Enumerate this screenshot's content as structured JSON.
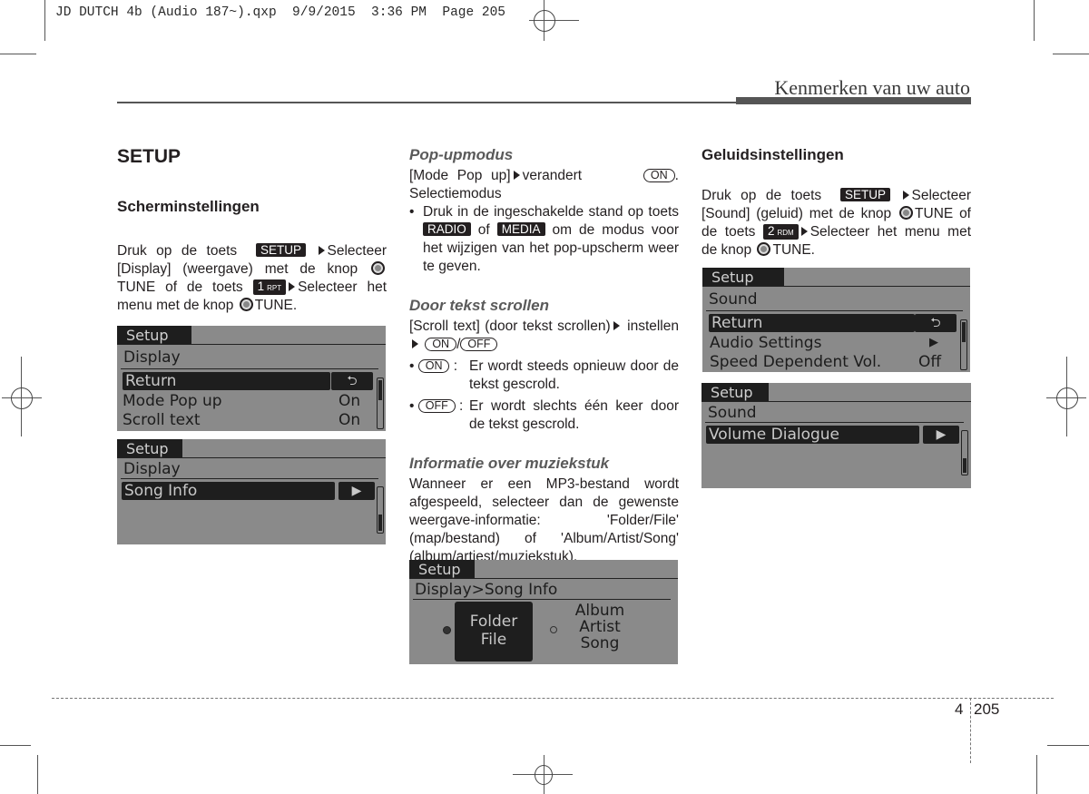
{
  "slug": "JD DUTCH 4b (Audio 187~).qxp  9/9/2015  3:36 PM  Page 205",
  "running_head": "Kenmerken van uw auto",
  "col1": {
    "title": "SETUP",
    "subtitle": "Scherminstellingen",
    "p1": "Druk op de toets",
    "key_setup": "SETUP",
    "p2": "Selecteer [Display] (weergave) met de knop",
    "p3": "TUNE of de toets",
    "key_1": "1",
    "key_1_sub": "RPT",
    "p4": "Selecteer het menu met de knop",
    "p5": "TUNE.",
    "lcd1": {
      "tab": "Setup",
      "crumb": "Display",
      "rows": [
        {
          "label": "Return",
          "value": "⮌",
          "selected": true
        },
        {
          "label": "Mode Pop up",
          "value": "On"
        },
        {
          "label": "Scroll text",
          "value": "On"
        }
      ]
    },
    "lcd2": {
      "tab": "Setup",
      "crumb": "Display",
      "rows": [
        {
          "label": "Song Info",
          "value": "▶",
          "selected": true
        }
      ]
    }
  },
  "col2": {
    "h_popup": "Pop-upmodus",
    "popup_p1": "[Mode Pop up]",
    "popup_p2": "verandert",
    "pill_on": "ON",
    "popup_p3": ".",
    "popup_p4": "Selectiemodus",
    "popup_bullet_a": "Druk in de ingeschakelde stand op toets",
    "key_radio": "RADIO",
    "of": "of",
    "key_media": "MEDIA",
    "popup_bullet_b": "om de modus voor het wijzigen van het pop-upscherm weer te geven.",
    "h_scroll": "Door tekst scrollen",
    "scroll_p1": "[Scroll text] (door tekst scrollen)",
    "scroll_p2": "instellen",
    "pill_off": "OFF",
    "slash": "/",
    "def_on": "Er wordt steeds opnieuw door de tekst gescrold.",
    "def_off": "Er wordt slechts één keer door de tekst gescrold.",
    "h_info": "Informatie over muziekstuk",
    "info_p": "Wanneer er een MP3-bestand wordt afgespeeld, selecteer dan de gewenste weergave-informatie: 'Folder/File' (map/bestand) of 'Album/Artist/Song' (album/artiest/muziekstuk).",
    "lcd3": {
      "tab": "Setup",
      "crumb": "Display>Song Info",
      "option_a_l1": "Folder",
      "option_a_l2": "File",
      "option_b_l1": "Album",
      "option_b_l2": "Artist",
      "option_b_l3": "Song",
      "selected": "Folder/File"
    }
  },
  "col3": {
    "subtitle": "Geluidsinstellingen",
    "p1": "Druk op de toets",
    "key_setup": "SETUP",
    "p2": "Selecteer [Sound] (geluid) met de knop",
    "p3": "TUNE of de toets",
    "key_2": "2",
    "key_2_sub": "RDM",
    "p4": "Selecteer het menu met de knop",
    "p5": "TUNE.",
    "lcd4": {
      "tab": "Setup",
      "crumb": "Sound",
      "rows": [
        {
          "label": "Return",
          "value": "⮌",
          "selected": true
        },
        {
          "label": "Audio Settings",
          "value": "▶"
        },
        {
          "label": "Speed Dependent Vol.",
          "value": "Off"
        }
      ]
    },
    "lcd5": {
      "tab": "Setup",
      "crumb": "Sound",
      "rows": [
        {
          "label": "Volume Dialogue",
          "value": "▶",
          "selected": true
        }
      ]
    }
  },
  "footer": {
    "chapter": "4",
    "page": "205"
  }
}
